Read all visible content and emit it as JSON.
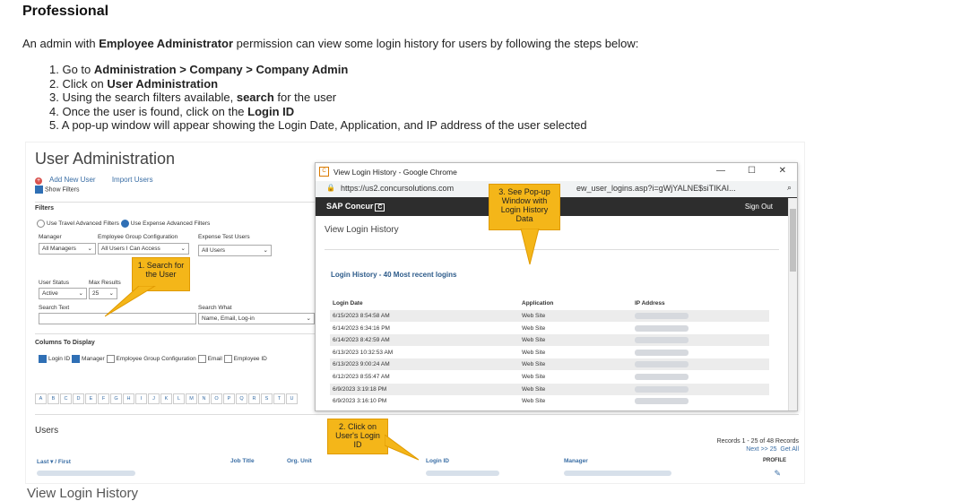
{
  "title": "Professional",
  "intro": {
    "prefix": "An admin with ",
    "bold": "Employee Administrator",
    "suffix": " permission can view some login history for users by following the steps below:"
  },
  "steps": [
    {
      "n": "1. ",
      "pre": "Go to ",
      "bold": "Administration > Company > Company Admin",
      "post": ""
    },
    {
      "n": "2. ",
      "pre": "Click on ",
      "bold": "User Administration",
      "post": ""
    },
    {
      "n": "3. ",
      "pre": "Using the search filters available, ",
      "bold": "search",
      "post": " for the user"
    },
    {
      "n": "4. ",
      "pre": "Once the user is found, click on the ",
      "bold": "Login ID",
      "post": ""
    },
    {
      "n": "5. ",
      "pre": "A pop-up window will appear showing the Login Date, Application, and IP address of the user selected",
      "bold": "",
      "post": ""
    }
  ],
  "ua": {
    "title": "User Administration",
    "add_new_user": "Add New User",
    "import_users": "Import Users",
    "show_filters": "Show Filters",
    "filters": "Filters",
    "radio_travel": "Use Travel Advanced Filters",
    "radio_expense": "Use Expense Advanced Filters",
    "manager_label": "Manager",
    "manager_value": "All Managers",
    "egc_label": "Employee Group Configuration",
    "egc_value": "All Users I Can Access",
    "etu_label": "Expense Test Users",
    "etu_value": "All Users",
    "status_label": "User Status",
    "status_value": "Active",
    "maxres_label": "Max Results",
    "maxres_value": "25",
    "search_text_label": "Search Text",
    "search_what_label": "Search What",
    "search_what_value": "Name, Email, Log-in",
    "columns_label": "Columns To Display",
    "columns": [
      "Login ID",
      "Manager",
      "Employee Group Configuration",
      "Email",
      "Employee ID"
    ],
    "alphabet": [
      "A",
      "B",
      "C",
      "D",
      "E",
      "F",
      "G",
      "H",
      "I",
      "J",
      "K",
      "L",
      "M",
      "N",
      "O",
      "P",
      "Q",
      "R",
      "S",
      "T",
      "U"
    ],
    "users": "Users",
    "records": "Records 1 - 25 of 48 Records",
    "next": "Next >> 25",
    "get_all": "Get All",
    "col_last_first": "Last ▾ / First",
    "col_job_title": "Job Title",
    "col_org_unit": "Org. Unit",
    "col_login_id": "Login ID",
    "col_manager": "Manager",
    "col_profile": "PROFILE"
  },
  "popup": {
    "window_title": "View Login History - Google Chrome",
    "url_left": "https://us2.concursolutions.com",
    "url_right": "ew_user_logins.asp?i=gWjYALNE$siTIKAI...",
    "brand": "SAP Concur",
    "brand_icon": "C",
    "sign_out": "Sign Out",
    "page_title": "View Login History",
    "section_title": "Login History - 40 Most recent logins",
    "col_date": "Login Date",
    "col_app": "Application",
    "col_ip": "IP Address",
    "rows": [
      {
        "date": "6/15/2023 8:54:58 AM",
        "app": "Web Site"
      },
      {
        "date": "6/14/2023 6:34:16 PM",
        "app": "Web Site"
      },
      {
        "date": "6/14/2023 8:42:59 AM",
        "app": "Web Site"
      },
      {
        "date": "6/13/2023 10:32:53 AM",
        "app": "Web Site"
      },
      {
        "date": "6/13/2023 9:00:24 AM",
        "app": "Web Site"
      },
      {
        "date": "6/12/2023 8:55:47 AM",
        "app": "Web Site"
      },
      {
        "date": "6/9/2023 3:19:18 PM",
        "app": "Web Site"
      },
      {
        "date": "6/9/2023 3:16:10 PM",
        "app": "Web Site"
      }
    ]
  },
  "callouts": {
    "c1": "1. Search for the User",
    "c2": "2. Click on User's Login ID",
    "c3": "3. See Pop-up Window with Login History Data"
  },
  "colors": {
    "callout": "#f4b619",
    "concur_bar": "#2d2d2d",
    "link": "#3a6ea5"
  }
}
